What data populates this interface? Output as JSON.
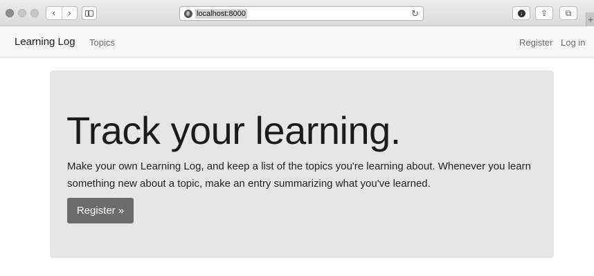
{
  "browser": {
    "url": "localhost:8000",
    "back_icon": "chevron-left-icon",
    "forward_icon": "chevron-right-icon",
    "back_glyph": "‹",
    "forward_glyph": "›",
    "reload_glyph": "↻",
    "share_glyph": "⇪",
    "tabs_glyph": "⧉",
    "newtab_glyph": "+"
  },
  "navbar": {
    "brand": "Learning Log",
    "links": {
      "topics": "Topics",
      "register": "Register",
      "login": "Log in"
    }
  },
  "jumbotron": {
    "heading": "Track your learning.",
    "lead": "Make your own Learning Log, and keep a list of the topics you're learning about. Whenever you learn something new about a topic, make an entry summarizing what you've learned.",
    "button": "Register »"
  },
  "colors": {
    "navbar_bg": "#f8f8f8",
    "jumbotron_bg": "#e6e6e6",
    "button_bg": "#6c6c6c"
  }
}
